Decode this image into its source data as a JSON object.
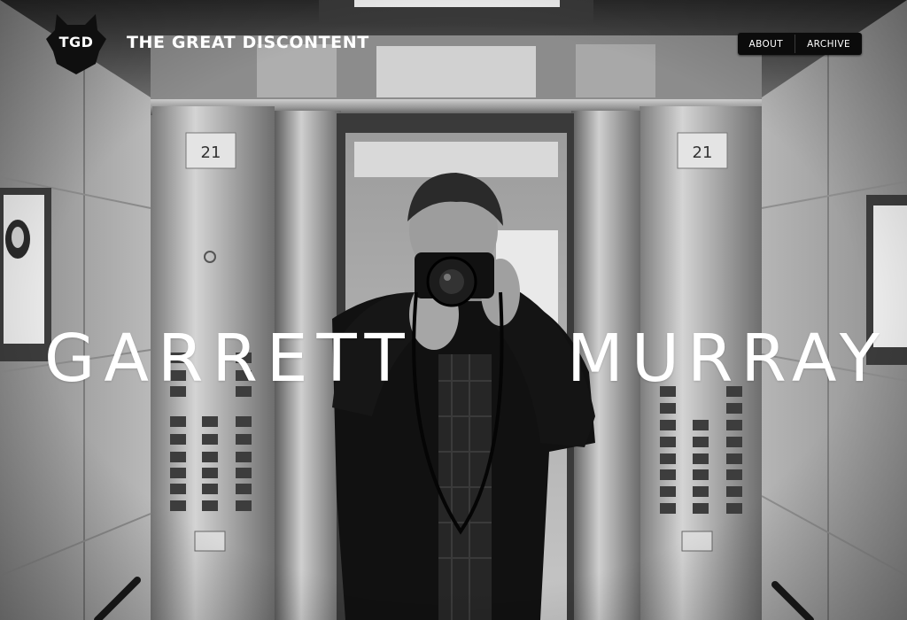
{
  "header": {
    "logo_text": "TGD",
    "site_title": "THE GREAT DISCONTENT"
  },
  "nav": {
    "items": [
      {
        "label": "ABOUT"
      },
      {
        "label": "ARCHIVE"
      }
    ]
  },
  "hero": {
    "first_name": "GARRETT",
    "last_name": "MURRAY",
    "photo_subject": "person-photographing-reflection-in-elevator"
  },
  "colors": {
    "nav_background": "#0b0b0b",
    "text": "#ffffff",
    "logo_badge": "#111111"
  }
}
